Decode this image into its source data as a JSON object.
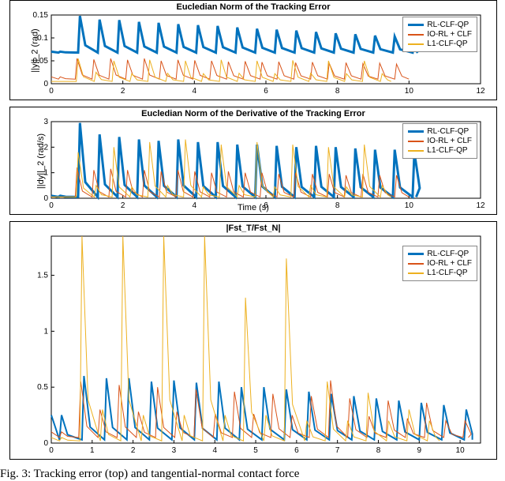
{
  "colors": {
    "rl": "#0072BD",
    "io": "#D95319",
    "l1": "#EDB120"
  },
  "legend_labels": [
    "RL-CLF-QP",
    "IO-RL + CLF",
    "L1-CLF-QP"
  ],
  "caption": "Fig. 3: Tracking error (top) and tangential-normal contact force",
  "chart_data": [
    {
      "type": "line",
      "title": "Eucledian Norm of the Tracking Error",
      "xlabel": "",
      "ylabel": "||y||_2 (rad)",
      "xlim": [
        0,
        12
      ],
      "ylim": [
        0,
        0.15
      ],
      "yticks": [
        0,
        0.05,
        0.1,
        0.15
      ],
      "xticks": [
        0,
        2,
        4,
        6,
        8,
        10,
        12
      ],
      "series": [
        {
          "name": "RL-CLF-QP",
          "color": "rl",
          "width": 3,
          "xmax": 10.2,
          "period": 0.55,
          "y": [
            0.07,
            0.148,
            0.14,
            0.139,
            0.135,
            0.133,
            0.13,
            0.128,
            0.126,
            0.123,
            0.12,
            0.118,
            0.116,
            0.113,
            0.11,
            0.108,
            0.105,
            0.103,
            0.098
          ],
          "low": 0.068
        },
        {
          "name": "IO-RL + CLF",
          "color": "io",
          "width": 1,
          "xmax": 10.0,
          "period": 0.47,
          "y": [
            0.015,
            0.055,
            0.053,
            0.055,
            0.052,
            0.055,
            0.05,
            0.052,
            0.051,
            0.05,
            0.048,
            0.049,
            0.047,
            0.048,
            0.046,
            0.047,
            0.045,
            0.046,
            0.044,
            0.045,
            0.043
          ],
          "low": 0.01
        },
        {
          "name": "L1-CLF-QP",
          "color": "l1",
          "width": 1,
          "xmax": 9.5,
          "period": 0.5,
          "y": [
            0.005,
            0.055,
            0.025,
            0.05,
            0.022,
            0.052,
            0.023,
            0.05,
            0.022,
            0.052,
            0.023,
            0.05,
            0.022,
            0.051,
            0.023,
            0.05,
            0.022,
            0.05,
            0.022
          ],
          "low": 0.005
        }
      ]
    },
    {
      "type": "line",
      "title": "Eucledian Norm of the Derivative of the Tracking Error",
      "xlabel": "Time (s)",
      "ylabel": "||dy||_2 (rad/s)",
      "xlim": [
        0,
        12
      ],
      "ylim": [
        0,
        3
      ],
      "yticks": [
        0,
        1,
        2,
        3
      ],
      "xticks": [
        0,
        2,
        4,
        6,
        8,
        10,
        12
      ],
      "series": [
        {
          "name": "RL-CLF-QP",
          "color": "rl",
          "width": 3,
          "xmax": 10.2,
          "period": 0.55,
          "y": [
            0.1,
            2.95,
            2.5,
            2.4,
            2.3,
            2.25,
            2.3,
            2.2,
            2.2,
            2.1,
            2.1,
            2.05,
            2.0,
            2.05,
            2.0,
            1.95,
            1.9,
            1.9,
            1.8
          ],
          "low": 0.05
        },
        {
          "name": "IO-RL + CLF",
          "color": "io",
          "width": 1,
          "xmax": 10.0,
          "period": 0.47,
          "y": [
            0.05,
            1.2,
            1.1,
            1.15,
            1.1,
            1.1,
            1.05,
            1.1,
            1.05,
            1.0,
            1.05,
            1.0,
            1.0,
            0.95,
            1.0,
            0.95,
            0.95,
            0.9,
            0.95,
            0.9,
            0.9
          ],
          "low": 0.05
        },
        {
          "name": "L1-CLF-QP",
          "color": "l1",
          "width": 1,
          "xmax": 9.5,
          "period": 0.5,
          "y": [
            0.05,
            1.8,
            0.5,
            2.0,
            0.45,
            2.2,
            0.5,
            2.3,
            0.45,
            2.1,
            0.5,
            2.2,
            0.45,
            2.1,
            0.5,
            2.0,
            0.45,
            2.1,
            0.5
          ],
          "low": 0.05
        }
      ]
    },
    {
      "type": "line",
      "title": "|Fst_T/Fst_N|",
      "xlabel": "",
      "ylabel": "",
      "xlim": [
        0,
        10.5
      ],
      "ylim": [
        0,
        1.85
      ],
      "yticks": [
        0,
        0.5,
        1,
        1.5
      ],
      "xticks": [
        0,
        1,
        2,
        3,
        4,
        5,
        6,
        7,
        8,
        9,
        10
      ],
      "series": [
        {
          "name": "RL-CLF-QP",
          "color": "rl",
          "width": 2,
          "xmax": 10.3,
          "period": 0.55,
          "y": [
            0.25,
            0.6,
            0.58,
            0.58,
            0.55,
            0.56,
            0.54,
            0.55,
            0.5,
            0.5,
            0.48,
            0.46,
            0.44,
            0.42,
            0.4,
            0.38,
            0.36,
            0.34,
            0.3
          ],
          "low": 0.03
        },
        {
          "name": "IO-RL + CLF",
          "color": "io",
          "width": 1,
          "xmax": 10.2,
          "period": 0.47,
          "y": [
            0.1,
            0.55,
            0.3,
            0.52,
            0.28,
            0.5,
            0.28,
            0.48,
            0.26,
            0.46,
            0.26,
            0.44,
            0.25,
            0.42,
            0.56,
            0.4,
            0.24,
            0.38,
            0.22,
            0.36,
            0.2,
            0.2
          ],
          "low": 0.05
        },
        {
          "name": "L1-CLF-QP",
          "color": "l1",
          "width": 1,
          "xmax": 9.5,
          "period": 0.5,
          "y": [
            0.05,
            1.85,
            0.3,
            1.85,
            0.25,
            1.85,
            0.25,
            1.85,
            0.25,
            1.3,
            0.25,
            1.65,
            0.2,
            0.55,
            0.2,
            0.45,
            0.2,
            0.3,
            0.2
          ],
          "low": 0.02
        }
      ]
    }
  ]
}
